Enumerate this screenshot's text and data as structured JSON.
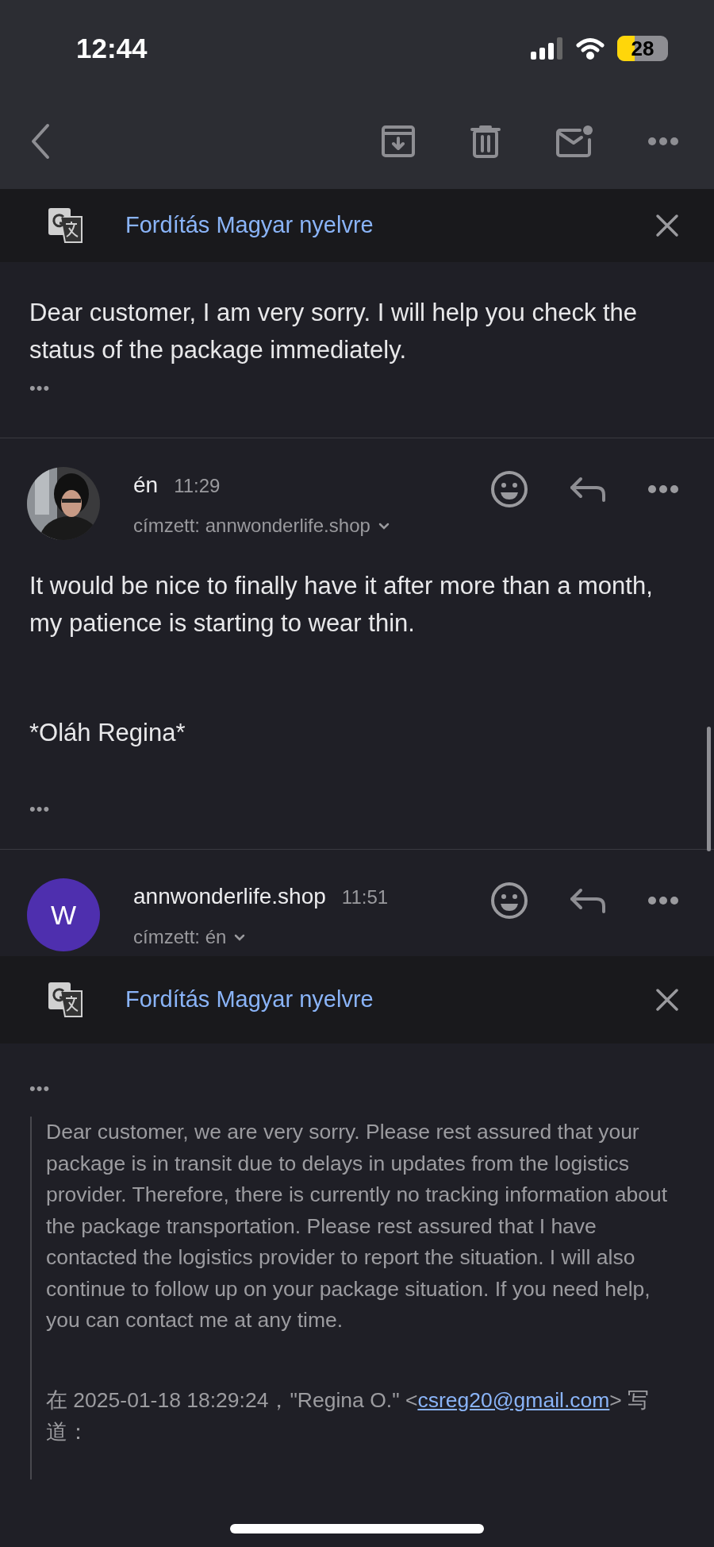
{
  "status_bar": {
    "time": "12:44",
    "battery": "28"
  },
  "top_message": {
    "translate_label": "Fordítás Magyar nyelvre",
    "body": "Dear customer, I am very sorry. I will help you check the status of the package immediately.",
    "more": "•••"
  },
  "messages": [
    {
      "sender": "én",
      "time": "11:29",
      "recipient": "címzett: annwonderlife.shop",
      "paragraphs": [
        "It would be nice to finally have it after more than a month, my patience is starting to wear thin.",
        "*Oláh Regina*"
      ],
      "more": "•••"
    },
    {
      "avatar": {
        "kind": "initial",
        "letter": "W"
      },
      "sender": "annwonderlife.shop",
      "time": "11:51",
      "recipient": "címzett: én",
      "translate_label": "Fordítás Magyar nyelvre",
      "more": "•••",
      "quote": "Dear customer, we are very sorry. Please rest assured that your package is in transit due to delays in updates from the logistics provider. Therefore, there is currently no tracking information about the package transportation. Please rest assured that I have contacted the logistics provider to report the situation. I will also continue to follow up on your package situation. If you need help, you can contact me at any time.",
      "attribution": {
        "before": "在 2025-01-18 18:29:24，\"Regina O.\" <",
        "email": "csreg20@gmail.com",
        "after": "> 写道："
      }
    }
  ]
}
